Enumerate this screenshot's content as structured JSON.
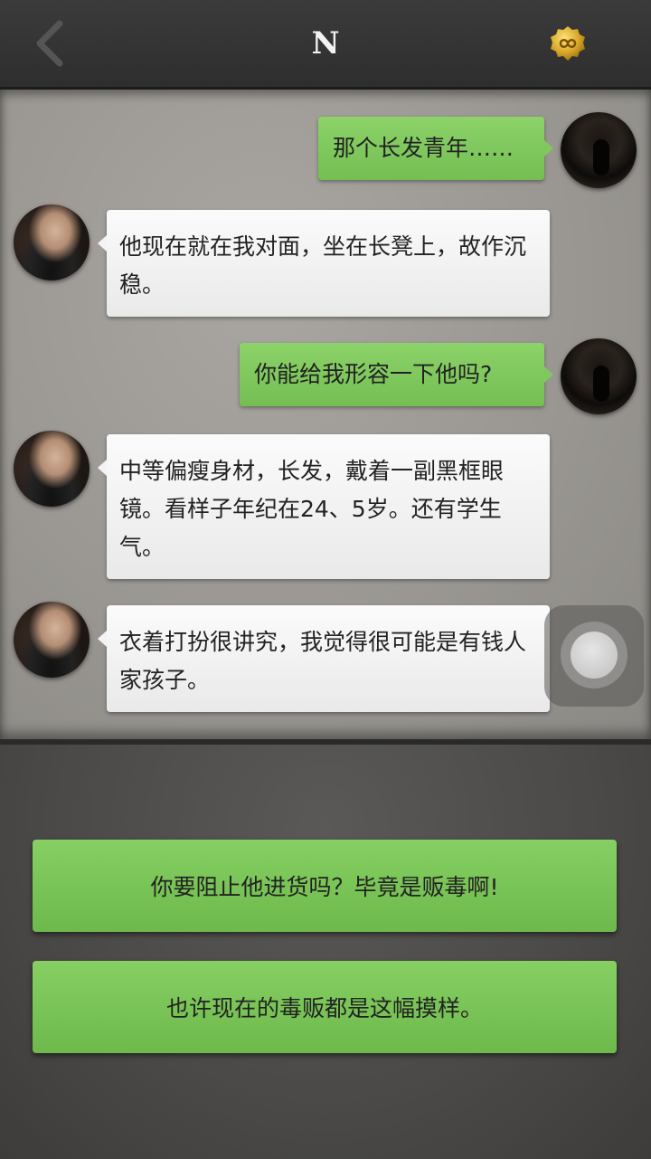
{
  "header": {
    "title": "N",
    "back_icon": "chevron-left-icon",
    "coin_icon": "coin-infinity-icon"
  },
  "messages": [
    {
      "sender": "me",
      "text": "那个长发青年……"
    },
    {
      "sender": "them",
      "text": "他现在就在我对面，坐在长凳上，故作沉稳。"
    },
    {
      "sender": "me",
      "text": "你能给我形容一下他吗?"
    },
    {
      "sender": "them",
      "text": "中等偏瘦身材，长发，戴着一副黑框眼镜。看样子年纪在24、5岁。还有学生气。"
    },
    {
      "sender": "them",
      "text": "衣着打扮很讲究，我觉得很可能是有钱人家孩子。"
    }
  ],
  "choices": [
    {
      "label": "你要阻止他进货吗？毕竟是贩毒啊!"
    },
    {
      "label": "也许现在的毒贩都是这幅摸样。"
    }
  ],
  "colors": {
    "bubble_me": "#7fc75c",
    "bubble_them": "#f4f4f4",
    "choice_button": "#7bc557",
    "topbar": "#333333"
  }
}
